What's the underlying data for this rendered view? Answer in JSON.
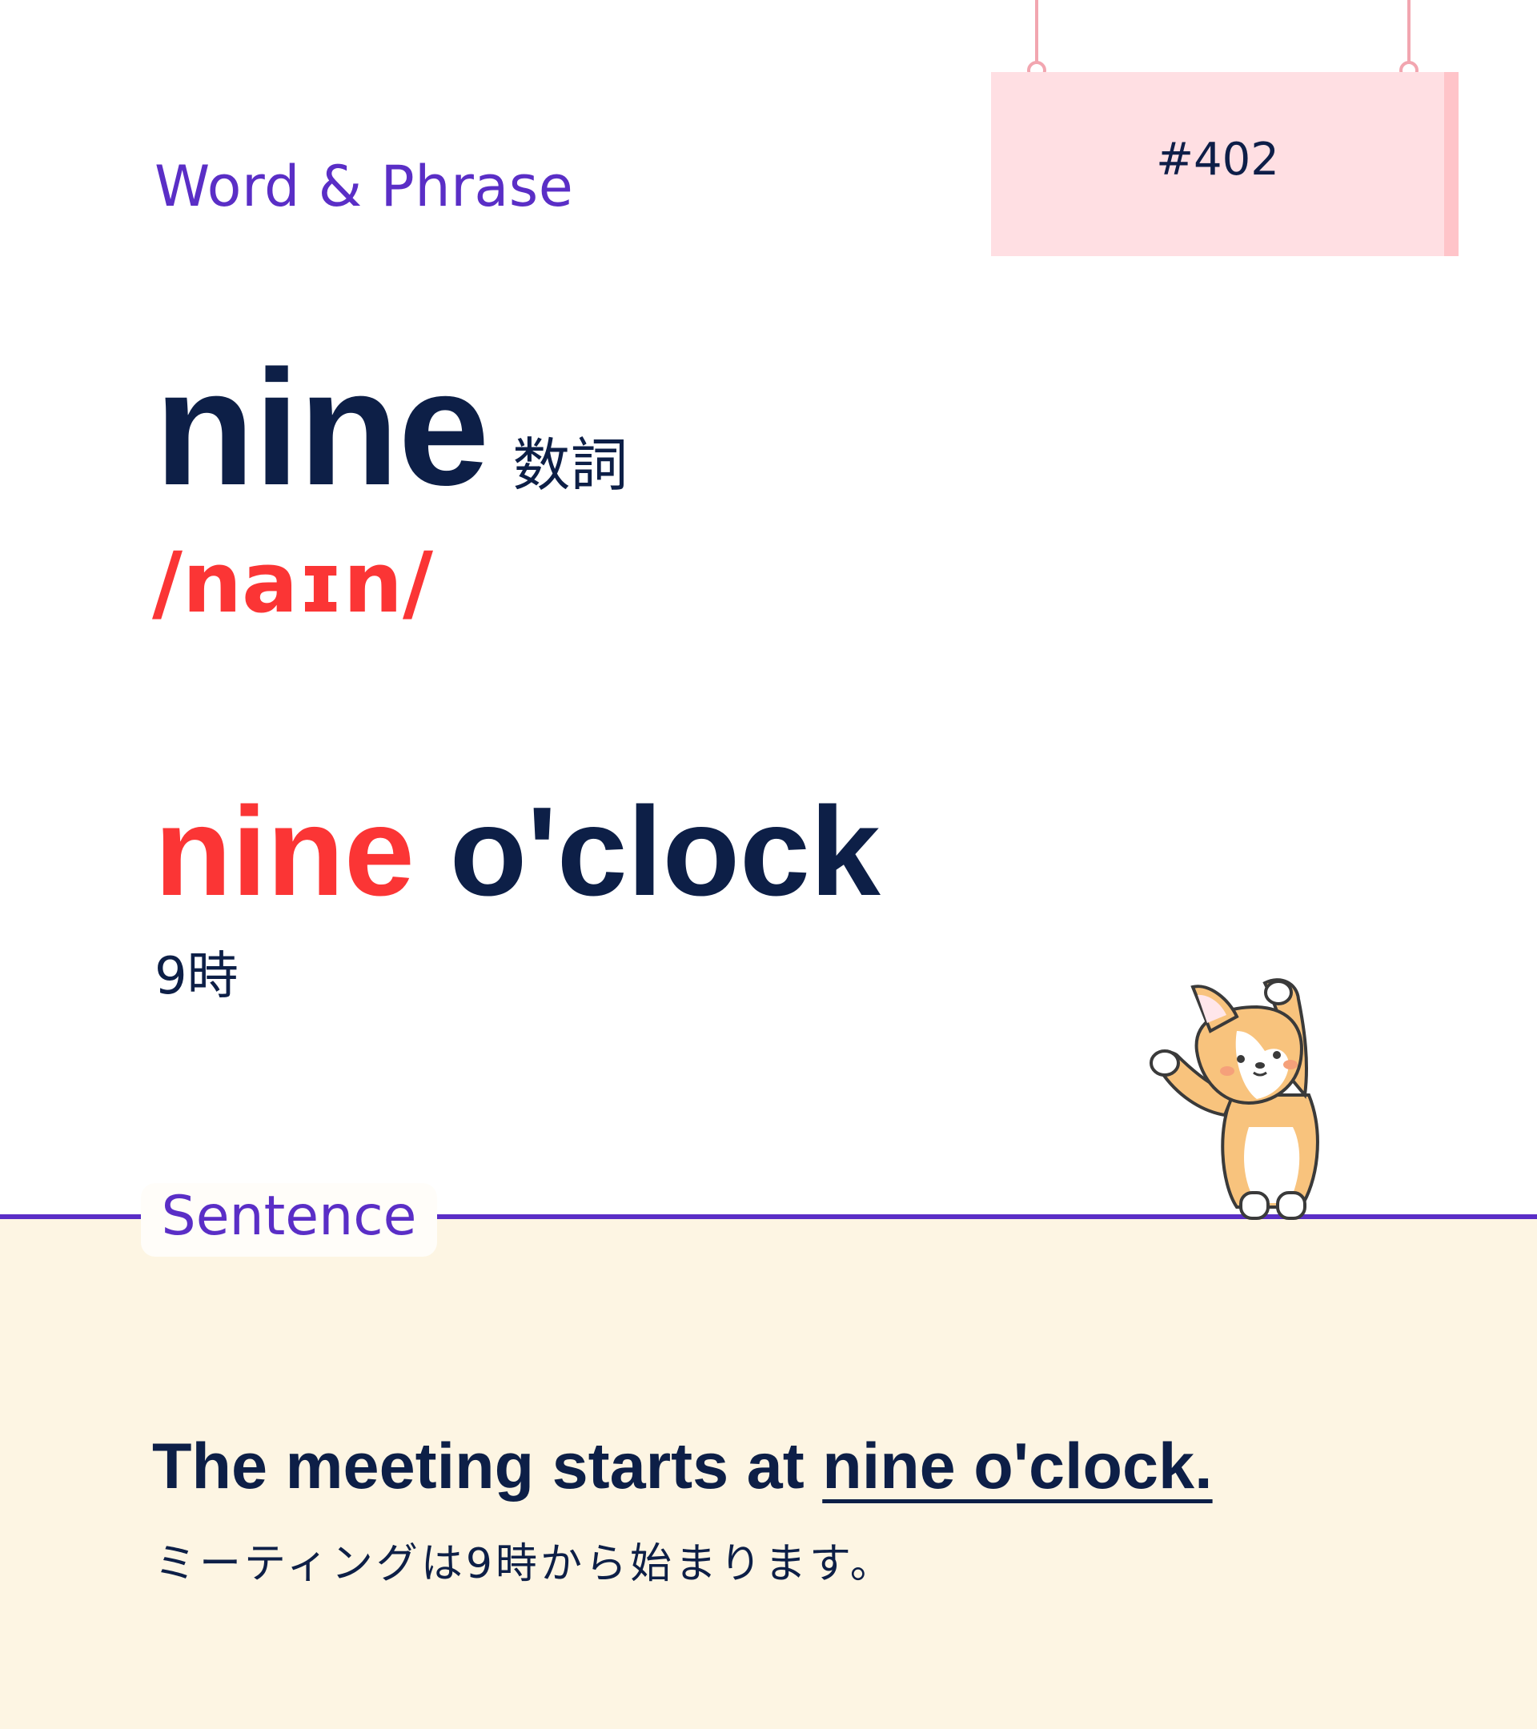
{
  "header": {
    "category_label": "Word & Phrase",
    "card_number": "#402"
  },
  "entry": {
    "headword": "nine",
    "part_of_speech": "数詞",
    "pronunciation": "/naɪn/"
  },
  "phrase": {
    "highlight": "nine",
    "rest": " o'clock",
    "meaning": "9時"
  },
  "sentence_section": {
    "label": "Sentence",
    "sentence_prefix": "The meeting starts at ",
    "sentence_highlight": "nine o'clock.",
    "translation": "ミーティングは9時から始まります。"
  },
  "colors": {
    "accent_purple": "#5a2ec6",
    "highlight_red": "#fb3535",
    "text_navy": "#0d1f47",
    "sign_pink": "#ffdfe3",
    "panel_cream": "#fdf5e3"
  },
  "icons": {
    "mascot": "corgi-mascot-icon"
  }
}
